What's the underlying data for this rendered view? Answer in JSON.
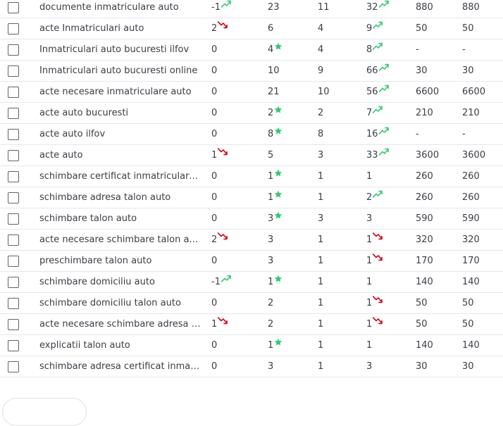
{
  "colors": {
    "trend_up": "#2ecc71",
    "trend_down": "#d0021b",
    "star": "#2ecc71",
    "divider": "#e6e6ea",
    "text": "#3c3c46"
  },
  "rows": [
    {
      "keyword": "documente inmatriculare auto",
      "pos": "-1",
      "pos_icon": "trend-up-icon",
      "best": "23",
      "best_icon": null,
      "n3": "11",
      "n4": "32",
      "n4_icon": "trend-up-icon",
      "vol": "880",
      "vol2": "880"
    },
    {
      "keyword": "acte Inmatriculari auto",
      "pos": "2",
      "pos_icon": "trend-down-icon",
      "best": "6",
      "best_icon": null,
      "n3": "4",
      "n4": "9",
      "n4_icon": "trend-up-icon",
      "vol": "50",
      "vol2": "50"
    },
    {
      "keyword": "Inmatriculari auto bucuresti ilfov",
      "pos": "0",
      "pos_icon": null,
      "best": "4",
      "best_icon": "star-icon",
      "n3": "4",
      "n4": "8",
      "n4_icon": "trend-up-icon",
      "vol": "-",
      "vol2": "-"
    },
    {
      "keyword": "Inmatriculari auto bucuresti online",
      "pos": "0",
      "pos_icon": null,
      "best": "10",
      "best_icon": null,
      "n3": "9",
      "n4": "66",
      "n4_icon": "trend-up-icon",
      "vol": "30",
      "vol2": "30"
    },
    {
      "keyword": "acte necesare inmatriculare auto",
      "pos": "0",
      "pos_icon": null,
      "best": "21",
      "best_icon": null,
      "n3": "10",
      "n4": "56",
      "n4_icon": "trend-up-icon",
      "vol": "6600",
      "vol2": "6600"
    },
    {
      "keyword": "acte auto bucuresti",
      "pos": "0",
      "pos_icon": null,
      "best": "2",
      "best_icon": "star-icon",
      "n3": "2",
      "n4": "7",
      "n4_icon": "trend-up-icon",
      "vol": "210",
      "vol2": "210"
    },
    {
      "keyword": "acte auto ilfov",
      "pos": "0",
      "pos_icon": null,
      "best": "8",
      "best_icon": "star-icon",
      "n3": "8",
      "n4": "16",
      "n4_icon": "trend-up-icon",
      "vol": "-",
      "vol2": "-"
    },
    {
      "keyword": "acte auto",
      "pos": "1",
      "pos_icon": "trend-down-icon",
      "best": "5",
      "best_icon": null,
      "n3": "3",
      "n4": "33",
      "n4_icon": "trend-up-icon",
      "vol": "3600",
      "vol2": "3600"
    },
    {
      "keyword": "schimbare certificat inmatriculare s...",
      "pos": "0",
      "pos_icon": null,
      "best": "1",
      "best_icon": "star-icon",
      "n3": "1",
      "n4": "1",
      "n4_icon": null,
      "vol": "260",
      "vol2": "260"
    },
    {
      "keyword": "schimbare adresa talon auto",
      "pos": "0",
      "pos_icon": null,
      "best": "1",
      "best_icon": "star-icon",
      "n3": "1",
      "n4": "2",
      "n4_icon": "trend-up-icon",
      "vol": "260",
      "vol2": "260"
    },
    {
      "keyword": "schimbare talon auto",
      "pos": "0",
      "pos_icon": null,
      "best": "3",
      "best_icon": "star-icon",
      "n3": "3",
      "n4": "3",
      "n4_icon": null,
      "vol": "590",
      "vol2": "590"
    },
    {
      "keyword": "acte necesare schimbare talon auto",
      "pos": "2",
      "pos_icon": "trend-down-icon",
      "best": "3",
      "best_icon": null,
      "n3": "1",
      "n4": "1",
      "n4_icon": "trend-down-icon",
      "vol": "320",
      "vol2": "320"
    },
    {
      "keyword": "preschimbare talon auto",
      "pos": "0",
      "pos_icon": null,
      "best": "3",
      "best_icon": null,
      "n3": "1",
      "n4": "1",
      "n4_icon": "trend-down-icon",
      "vol": "170",
      "vol2": "170"
    },
    {
      "keyword": "schimbare domiciliu auto",
      "pos": "-1",
      "pos_icon": "trend-up-icon",
      "best": "1",
      "best_icon": "star-icon",
      "n3": "1",
      "n4": "1",
      "n4_icon": null,
      "vol": "140",
      "vol2": "140"
    },
    {
      "keyword": "schimbare domiciliu talon auto",
      "pos": "0",
      "pos_icon": null,
      "best": "2",
      "best_icon": null,
      "n3": "1",
      "n4": "1",
      "n4_icon": "trend-down-icon",
      "vol": "50",
      "vol2": "50"
    },
    {
      "keyword": "acte necesare schimbare adresa talo...",
      "pos": "1",
      "pos_icon": "trend-down-icon",
      "best": "2",
      "best_icon": null,
      "n3": "1",
      "n4": "1",
      "n4_icon": "trend-down-icon",
      "vol": "50",
      "vol2": "50"
    },
    {
      "keyword": "explicatii talon auto",
      "pos": "0",
      "pos_icon": null,
      "best": "1",
      "best_icon": "star-icon",
      "n3": "1",
      "n4": "1",
      "n4_icon": null,
      "vol": "140",
      "vol2": "140"
    },
    {
      "keyword": "schimbare adresa certificat inmatric...",
      "pos": "0",
      "pos_icon": null,
      "best": "3",
      "best_icon": null,
      "n3": "1",
      "n4": "3",
      "n4_icon": null,
      "vol": "30",
      "vol2": "30"
    }
  ]
}
